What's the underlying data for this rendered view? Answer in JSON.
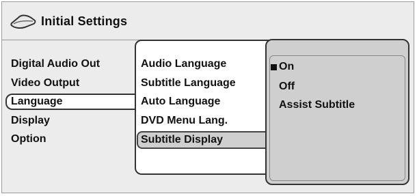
{
  "header": {
    "title": "Initial Settings",
    "icon": "disc-icon"
  },
  "left_menu": {
    "items": [
      "Digital Audio Out",
      "Video Output",
      "Language",
      "Display",
      "Option"
    ],
    "selected": "Language"
  },
  "language_menu": {
    "items": [
      "Audio Language",
      "Subtitle Language",
      "Auto Language",
      "DVD Menu Lang.",
      "Subtitle Display"
    ],
    "selected": "Subtitle Display"
  },
  "options": {
    "items": [
      "On",
      "Off",
      "Assist Subtitle"
    ],
    "current": "On"
  }
}
